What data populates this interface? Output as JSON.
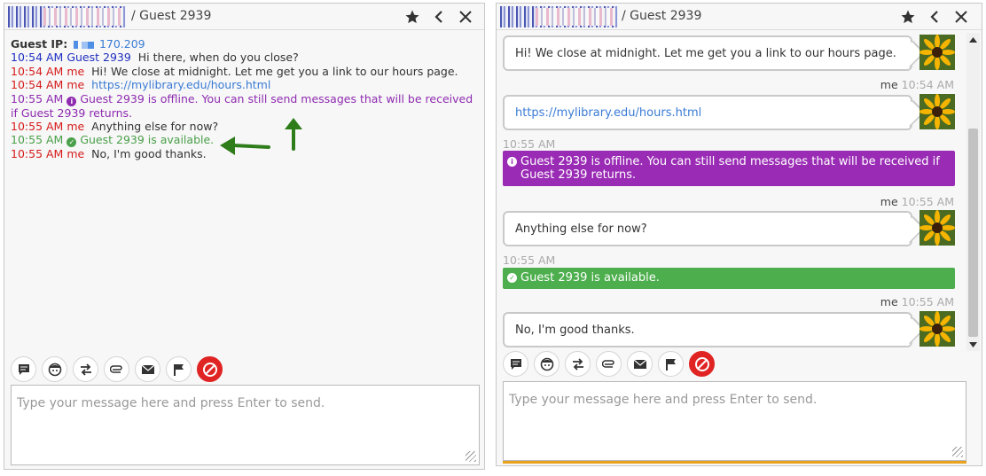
{
  "left_window": {
    "title": "/ Guest 2939",
    "guest_ip_label": "Guest IP:",
    "guest_ip_value": "170.209",
    "transcript": [
      {
        "time": "10:54 AM",
        "sender": "Guest 2939",
        "text": "Hi there, when do you close?",
        "kind": "guest"
      },
      {
        "time": "10:54 AM",
        "sender": "me",
        "text": "Hi! We close at midnight. Let me get you a link to our hours page.",
        "kind": "me"
      },
      {
        "time": "10:54 AM",
        "sender": "me",
        "text": "https://mylibrary.edu/hours.html",
        "kind": "me-link"
      },
      {
        "time": "10:55 AM",
        "sender": "",
        "text": "Guest 2939 is offline. You can still send messages that will be received if Guest 2939 returns.",
        "kind": "offline"
      },
      {
        "time": "10:55 AM",
        "sender": "me",
        "text": "Anything else for now?",
        "kind": "me"
      },
      {
        "time": "10:55 AM",
        "sender": "",
        "text": "Guest 2939 is available.",
        "kind": "available"
      },
      {
        "time": "10:55 AM",
        "sender": "me",
        "text": "No, I'm good thanks.",
        "kind": "me"
      }
    ],
    "composer_placeholder": "Type your message here and press Enter to send."
  },
  "right_window": {
    "title": "/ Guest 2939",
    "messages": {
      "m1_text": "Hi! We close at midnight. Let me get you a link to our hours page.",
      "m1_sender": "me",
      "m1_time": "10:54 AM",
      "m2_link": "https://mylibrary.edu/hours.html",
      "sys1_time": "10:55 AM",
      "offline_notice": "Guest 2939 is offline. You can still send messages that will be received if Guest 2939 returns.",
      "m3_sender": "me",
      "m3_time": "10:55 AM",
      "m3_text": "Anything else for now?",
      "sys2_time": "10:55 AM",
      "available_notice": "Guest 2939 is available.",
      "m4_sender": "me",
      "m4_time": "10:55 AM",
      "m4_text": "No, I'm good thanks."
    },
    "composer_placeholder": "Type your message here and press Enter to send."
  },
  "toolbar_icons": [
    "chat-bubble-icon",
    "smiley-icon",
    "transfer-icon",
    "paperclip-icon",
    "envelope-icon",
    "flag-icon",
    "block-icon"
  ],
  "colors": {
    "guest": "#1f2fc2",
    "me": "#d61b1b",
    "link": "#3a7bd5",
    "offline": "#9a2bb5",
    "available": "#4cae4c",
    "block": "#e02424"
  }
}
